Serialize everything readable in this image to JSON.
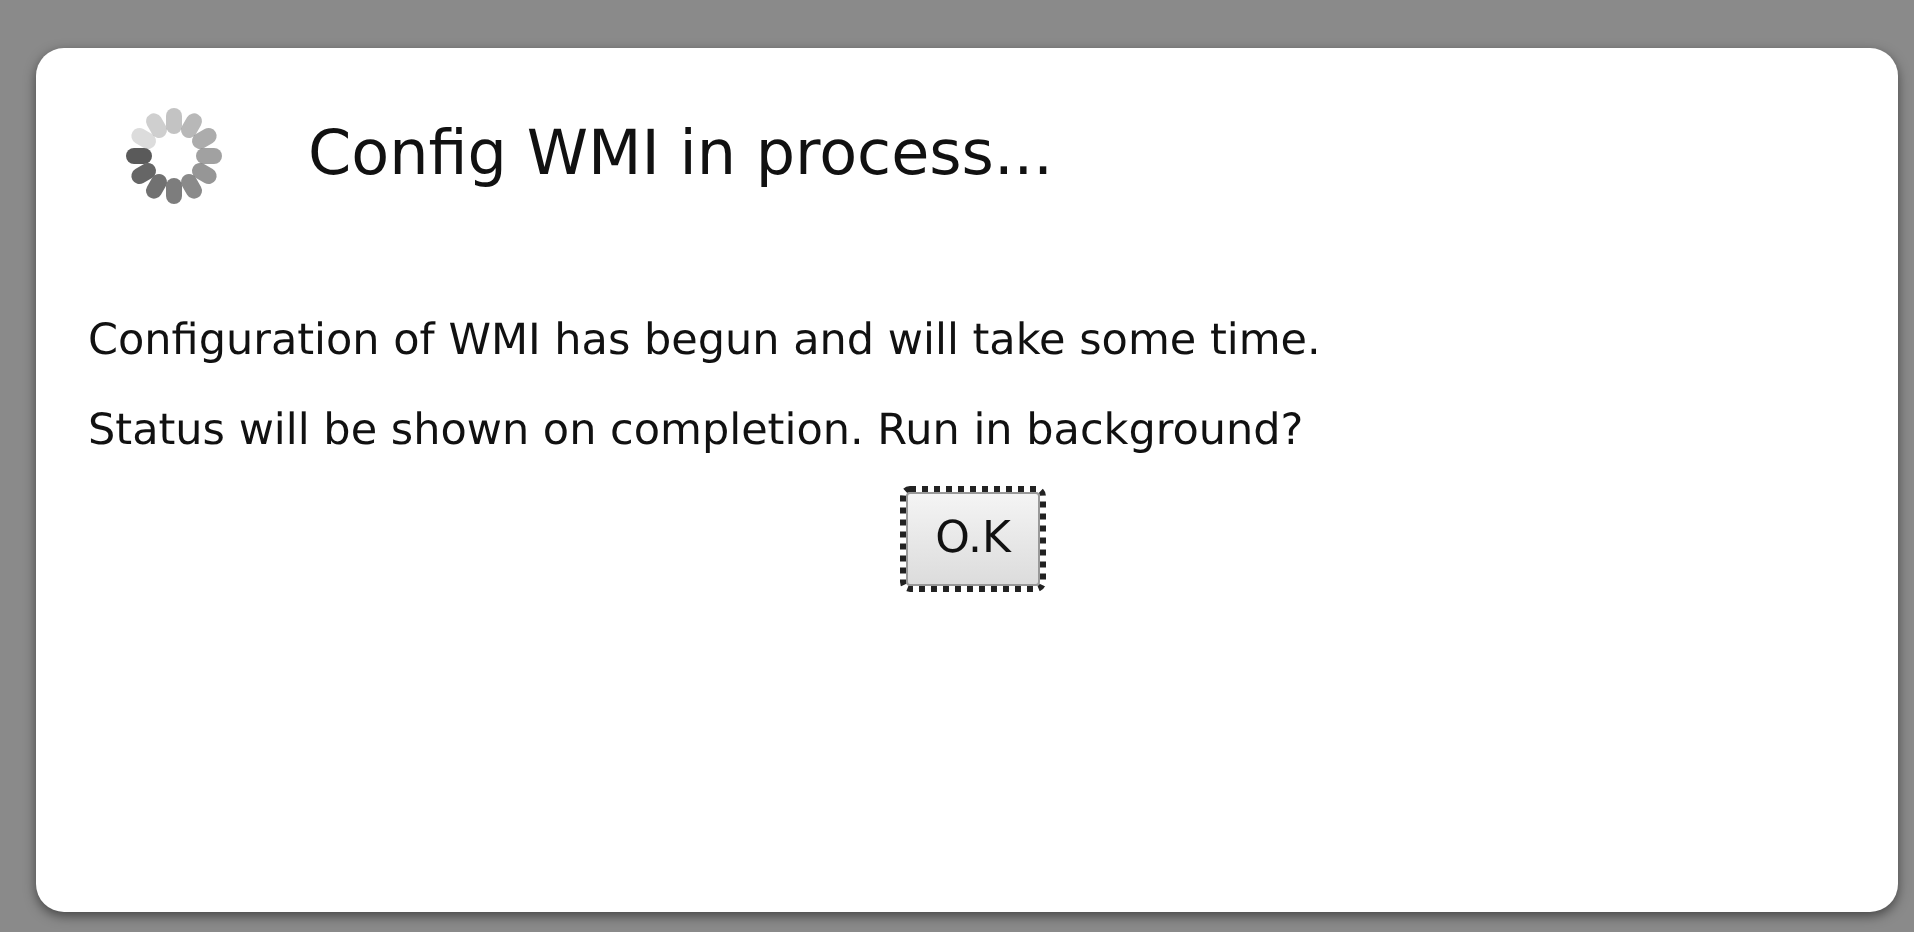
{
  "dialog": {
    "title": "Config WMI in process...",
    "message_lines": [
      "Configuration of WMI has begun and will take some time.",
      "Status will be shown on completion. Run in background?"
    ],
    "button": {
      "label": "O.K",
      "focused": true
    }
  }
}
